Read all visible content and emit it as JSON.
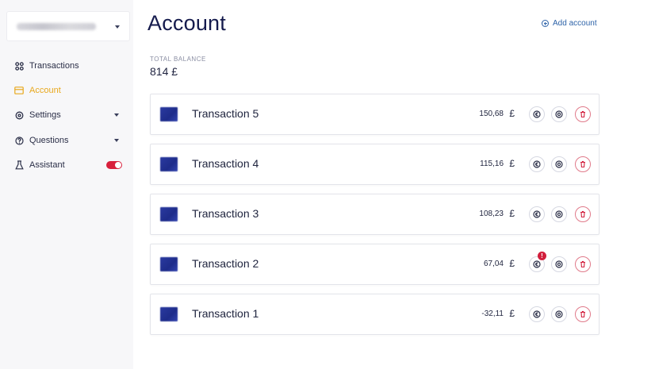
{
  "sidebar": {
    "account_selector": {
      "value": ""
    },
    "items": [
      {
        "label": "Transactions",
        "icon": "grid-icon",
        "active": false
      },
      {
        "label": "Account",
        "icon": "card-icon",
        "active": true
      },
      {
        "label": "Settings",
        "icon": "gear-icon",
        "active": false,
        "expandable": true
      },
      {
        "label": "Questions",
        "icon": "question-icon",
        "active": false,
        "expandable": true
      },
      {
        "label": "Assistant",
        "icon": "flask-icon",
        "active": false,
        "toggle": true,
        "toggle_on": true
      }
    ]
  },
  "header": {
    "title": "Account",
    "add_account_label": "Add account"
  },
  "balance": {
    "label": "TOTAL BALANCE",
    "value": "814 £"
  },
  "transactions": [
    {
      "name": "Transaction 5",
      "amount": "150,68",
      "currency": "£"
    },
    {
      "name": "Transaction 4",
      "amount": "115,16",
      "currency": "£"
    },
    {
      "name": "Transaction 3",
      "amount": "108,23",
      "currency": "£"
    },
    {
      "name": "Transaction 2",
      "amount": "67,04",
      "currency": "£",
      "badge": "!"
    },
    {
      "name": "Transaction 1",
      "amount": "-32,11",
      "currency": "£"
    }
  ],
  "colors": {
    "accent_active": "#e8a81d",
    "title": "#151b4d",
    "link": "#2e63a8",
    "danger": "#d21f3c"
  }
}
